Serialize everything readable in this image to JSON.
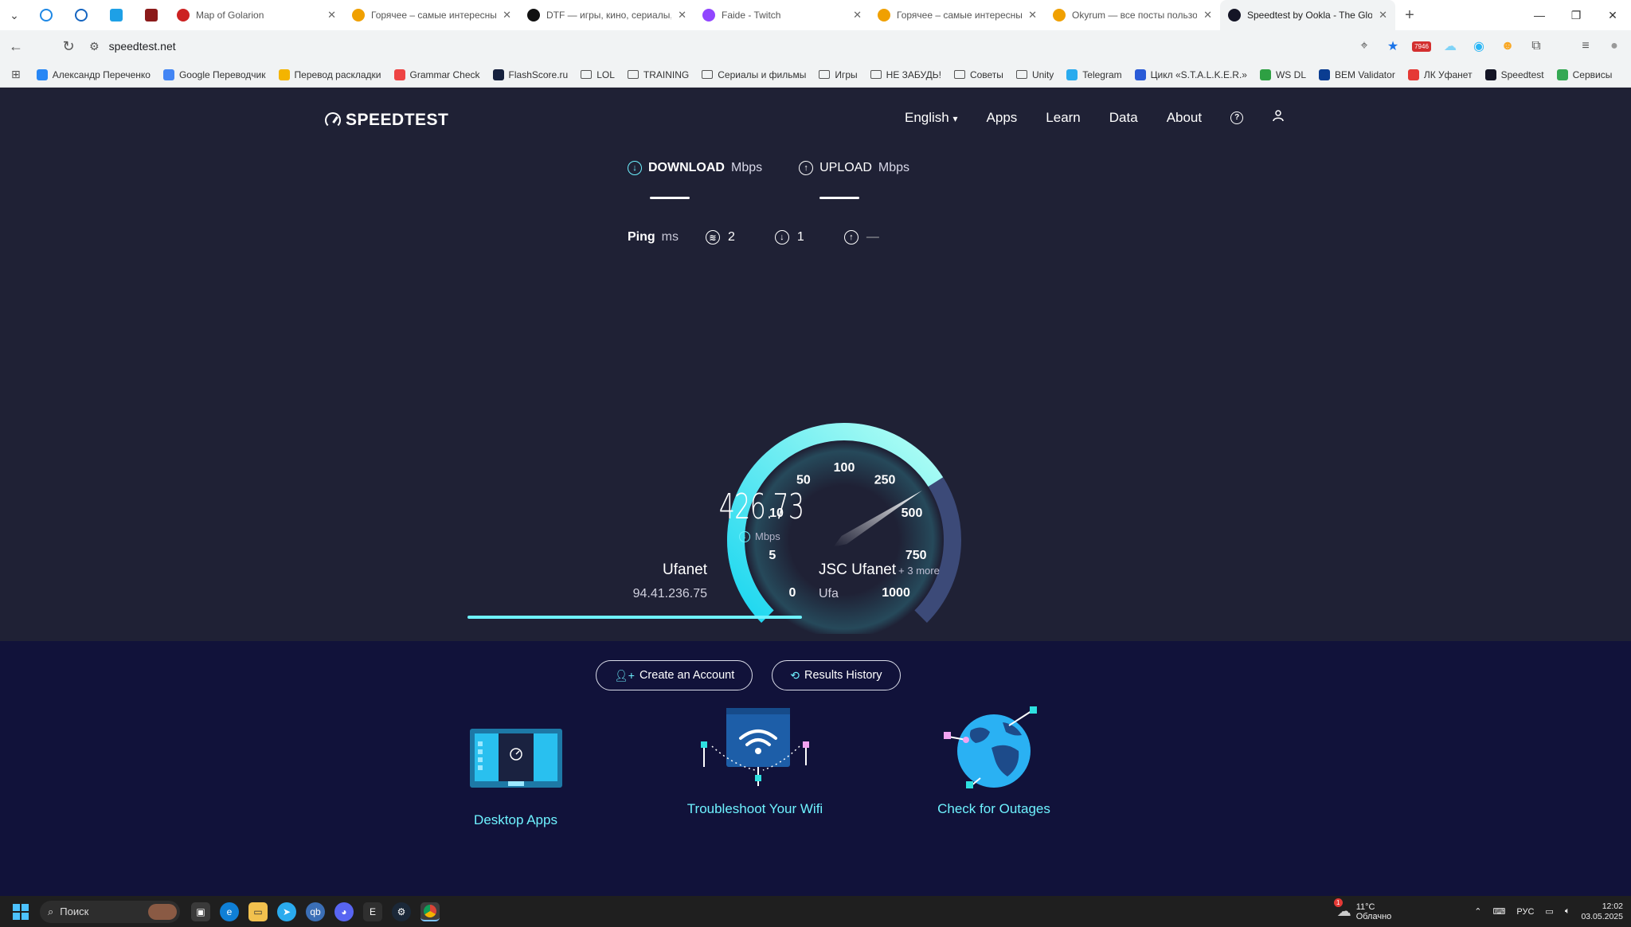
{
  "browser": {
    "tabs": [
      {
        "title": "Map of Golarion",
        "color": "#c22"
      },
      {
        "title": "Горячее – самые интересные и",
        "color": "#f0a000"
      },
      {
        "title": "DTF — игры, кино, сериалы, ра",
        "color": "#111"
      },
      {
        "title": "Faide - Twitch",
        "color": "#9146ff"
      },
      {
        "title": "Горячее – самые интересные и",
        "color": "#f0a000"
      },
      {
        "title": "Okyrum — все посты пользоват",
        "color": "#f0a000"
      },
      {
        "title": "Speedtest by Ookla - The Global",
        "color": "#141526"
      }
    ],
    "url": "speedtest.net",
    "bookmarks": [
      {
        "label": "Александр Переченко",
        "type": "link",
        "color": "#2787f5"
      },
      {
        "label": "Google Переводчик",
        "type": "link",
        "color": "#4285f4"
      },
      {
        "label": "Перевод раскладки",
        "type": "link",
        "color": "#f4b400"
      },
      {
        "label": "Grammar Check",
        "type": "link",
        "color": "#e44"
      },
      {
        "label": "FlashScore.ru",
        "type": "link",
        "color": "#16213e"
      },
      {
        "label": "LOL",
        "type": "folder"
      },
      {
        "label": "TRAINING",
        "type": "folder"
      },
      {
        "label": "Сериалы и фильмы",
        "type": "folder"
      },
      {
        "label": "Игры",
        "type": "folder"
      },
      {
        "label": "НЕ ЗАБУДЬ!",
        "type": "folder"
      },
      {
        "label": "Советы",
        "type": "folder"
      },
      {
        "label": "Unity",
        "type": "folder"
      },
      {
        "label": "Telegram",
        "type": "link",
        "color": "#2aabee"
      },
      {
        "label": "Цикл «S.T.A.L.K.E.R.»",
        "type": "link",
        "color": "#2a5bd7"
      },
      {
        "label": "WS DL",
        "type": "link",
        "color": "#2ea043"
      },
      {
        "label": "BEM Validator",
        "type": "link",
        "color": "#0b3d91"
      },
      {
        "label": "ЛК Уфанет",
        "type": "link",
        "color": "#e53935"
      },
      {
        "label": "Speedtest",
        "type": "link",
        "color": "#141526"
      },
      {
        "label": "Сервисы",
        "type": "link",
        "color": "#34a853"
      }
    ]
  },
  "speedtest": {
    "logo": "SPEEDTEST",
    "nav": {
      "language": "English",
      "apps": "Apps",
      "learn": "Learn",
      "data": "Data",
      "about": "About"
    },
    "download": {
      "label": "DOWNLOAD",
      "unit": "Mbps"
    },
    "upload": {
      "label": "UPLOAD",
      "unit": "Mbps"
    },
    "ping": {
      "label": "Ping",
      "unit": "ms",
      "idle": "2",
      "download": "1",
      "upload": "—"
    },
    "gauge": {
      "ticks": [
        "0",
        "5",
        "10",
        "50",
        "100",
        "250",
        "500",
        "750",
        "1000"
      ],
      "value": 426.73,
      "value_text": "426.73",
      "unit": "Mbps"
    },
    "isp": {
      "name": "Ufanet",
      "ip": "94.41.236.75"
    },
    "server": {
      "name": "JSC Ufanet",
      "more": "+ 3 more",
      "city": "Ufa"
    },
    "buttons": {
      "create_account": "Create an Account",
      "results_history": "Results History"
    },
    "features": {
      "desktop": "Desktop Apps",
      "wifi": "Troubleshoot Your Wifi",
      "outages": "Check for Outages"
    },
    "colors": {
      "accent": "#6ef2ff",
      "bg_top": "#1f2135",
      "bg_bottom": "#11123a"
    }
  },
  "taskbar": {
    "search_placeholder": "Поиск",
    "weather_temp": "11°C",
    "weather_desc": "Облачно",
    "lang": "РУС",
    "time": "12:02",
    "date": "03.05.2025",
    "badge": "1"
  }
}
